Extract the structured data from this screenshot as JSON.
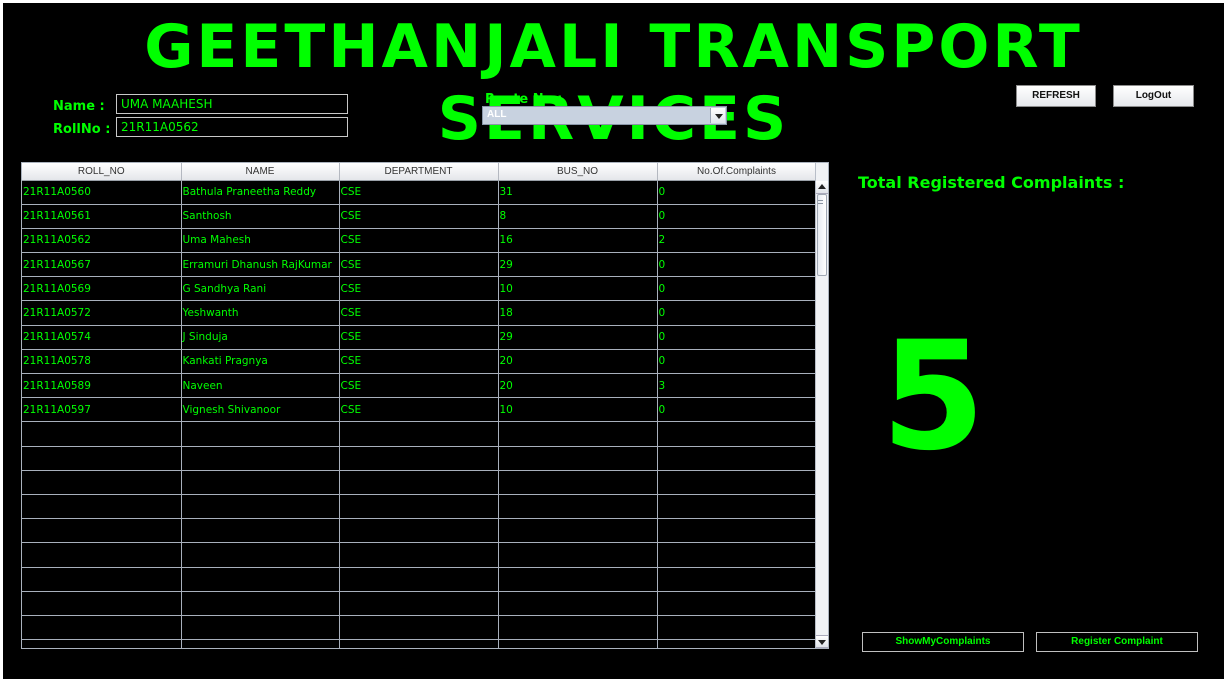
{
  "app": {
    "title": "GEETHANJALI TRANSPORT SERVICES"
  },
  "user": {
    "name_label": "Name :",
    "name_value": "UMA MAAHESH",
    "roll_label": "RollNo :",
    "roll_value": "21R11A0562"
  },
  "route": {
    "label": "Route No :",
    "selected": "ALL"
  },
  "toolbar": {
    "refresh_label": "REFRESH",
    "logout_label": "LogOut"
  },
  "table": {
    "columns": [
      "ROLL_NO",
      "NAME",
      "DEPARTMENT",
      "BUS_NO",
      "No.Of.Complaints"
    ],
    "rows": [
      [
        "21R11A0560",
        "Bathula Praneetha Reddy",
        "CSE",
        "31",
        "0"
      ],
      [
        "21R11A0561",
        "Santhosh",
        "CSE",
        "8",
        "0"
      ],
      [
        "21R11A0562",
        "Uma Mahesh",
        "CSE",
        "16",
        "2"
      ],
      [
        "21R11A0567",
        "Erramuri Dhanush RajKumar",
        "CSE",
        "29",
        "0"
      ],
      [
        "21R11A0569",
        "G Sandhya Rani",
        "CSE",
        "10",
        "0"
      ],
      [
        "21R11A0572",
        "Yeshwanth",
        "CSE",
        "18",
        "0"
      ],
      [
        "21R11A0574",
        "J Sinduja",
        "CSE",
        "29",
        "0"
      ],
      [
        "21R11A0578",
        "Kankati Pragnya",
        "CSE",
        "20",
        "0"
      ],
      [
        "21R11A0589",
        "Naveen",
        "CSE",
        "20",
        "3"
      ],
      [
        "21R11A0597",
        "Vignesh Shivanoor",
        "CSE",
        "10",
        "0"
      ]
    ],
    "empty_rows": 10
  },
  "summary": {
    "total_label": "Total Registered Complaints :",
    "total_value": "5"
  },
  "actions": {
    "show_my_label": "ShowMyComplaints",
    "register_label": "Register Complaint"
  },
  "colors": {
    "accent": "#00ff00",
    "background": "#000000"
  }
}
